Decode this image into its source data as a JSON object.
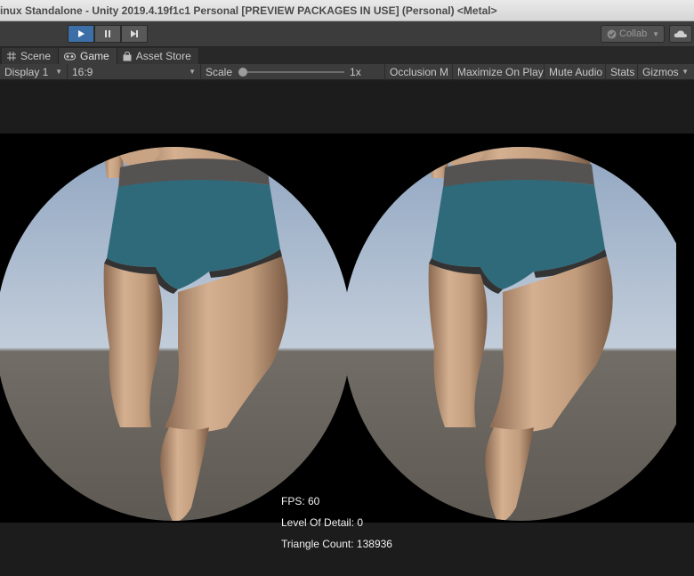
{
  "window": {
    "title": "inux Standalone - Unity 2019.4.19f1c1 Personal [PREVIEW PACKAGES IN USE] (Personal) <Metal>"
  },
  "toolbar": {
    "play_icon": "play-icon",
    "pause_icon": "pause-icon",
    "step_icon": "step-icon",
    "collab_label": "Collab",
    "cloud_icon": "cloud-icon"
  },
  "tabs": [
    {
      "label": "Scene",
      "icon": "grid-icon"
    },
    {
      "label": "Game",
      "icon": "gamepad-icon"
    },
    {
      "label": "Asset Store",
      "icon": "bag-icon"
    }
  ],
  "gamebar": {
    "display": "Display 1",
    "aspect": "16:9",
    "scale_label": "Scale",
    "scale_value": "1x",
    "scale_level": 0.0,
    "occlusion": "Occlusion M",
    "maximize": "Maximize On Play",
    "mute": "Mute Audio",
    "stats": "Stats",
    "gizmos": "Gizmos"
  },
  "overlay": {
    "fps": "FPS: 60",
    "lod": "Level Of Detail: 0",
    "triangles": "Triangle Count: 138936"
  },
  "colors": {
    "accent": "#3c6fa8",
    "sky": "#a9b9cd",
    "floor": "#6a6560",
    "skin": "#c9a585",
    "shorts": "#2f6a7a"
  }
}
